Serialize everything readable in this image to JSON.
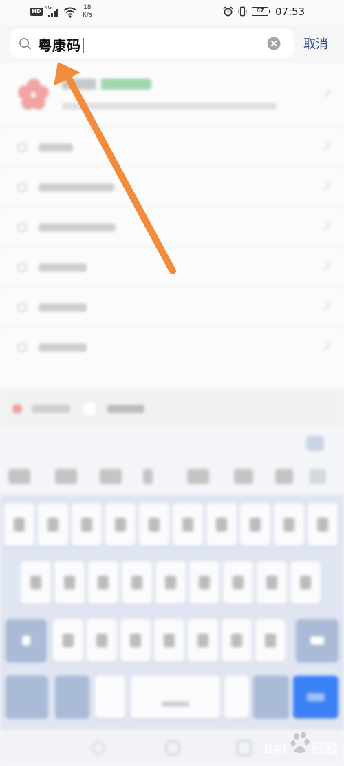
{
  "status_bar": {
    "hd_badge": "HD",
    "network_type": "4G",
    "speed_value": "18",
    "speed_unit": "K/s",
    "battery": "67",
    "time": "07:53"
  },
  "search": {
    "query": "粤康码",
    "cancel_label": "取消"
  },
  "keyboard": {
    "row1_keys": 10,
    "row2_keys": 9,
    "row3_keys": 7
  },
  "watermark": {
    "brand_prefix": "Bai",
    "brand_suffix": "经验"
  },
  "colors": {
    "cancel": "#2f4f82",
    "arrow": "#f28c3c",
    "caret": "#16a34a",
    "keyboard_blue": "#3b82f6"
  }
}
